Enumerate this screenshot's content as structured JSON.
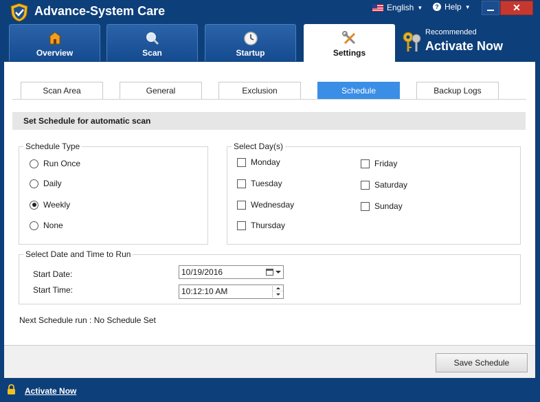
{
  "window": {
    "title": "Advance-System Care",
    "language_label": "English",
    "help_label": "Help"
  },
  "nav": {
    "tabs": [
      {
        "label": "Overview",
        "icon": "home-icon"
      },
      {
        "label": "Scan",
        "icon": "magnifier-icon"
      },
      {
        "label": "Startup",
        "icon": "clock-icon"
      },
      {
        "label": "Settings",
        "icon": "tools-icon",
        "active": true
      }
    ],
    "recommend_small": "Recommended",
    "recommend_big": "Activate Now"
  },
  "subtabs": [
    {
      "label": "Scan Area"
    },
    {
      "label": "General"
    },
    {
      "label": "Exclusion"
    },
    {
      "label": "Schedule",
      "active": true
    },
    {
      "label": "Backup Logs"
    }
  ],
  "section_title": "Set Schedule for automatic scan",
  "schedule_type": {
    "title": "Schedule Type",
    "options": [
      {
        "label": "Run Once",
        "checked": false
      },
      {
        "label": "Daily",
        "checked": false
      },
      {
        "label": "Weekly",
        "checked": true
      },
      {
        "label": "None",
        "checked": false
      }
    ]
  },
  "select_days": {
    "title": "Select Day(s)",
    "days": [
      {
        "label": "Monday",
        "checked": false
      },
      {
        "label": "Tuesday",
        "checked": false
      },
      {
        "label": "Wednesday",
        "checked": false
      },
      {
        "label": "Thursday",
        "checked": false
      },
      {
        "label": "Friday",
        "checked": false
      },
      {
        "label": "Saturday",
        "checked": false
      },
      {
        "label": "Sunday",
        "checked": false
      }
    ]
  },
  "date_time": {
    "title": "Select Date and Time to Run",
    "start_date_label": "Start Date:",
    "start_date_value": "10/19/2016",
    "start_time_label": "Start Time:",
    "start_time_value": "10:12:10 AM"
  },
  "next_run": "Next Schedule run : No Schedule Set",
  "save_button": "Save Schedule",
  "footer": {
    "activate_label": "Activate Now"
  },
  "colors": {
    "frame": "#0d3f7a",
    "active_subtab": "#3a8ee6",
    "close_button": "#c6382f"
  }
}
